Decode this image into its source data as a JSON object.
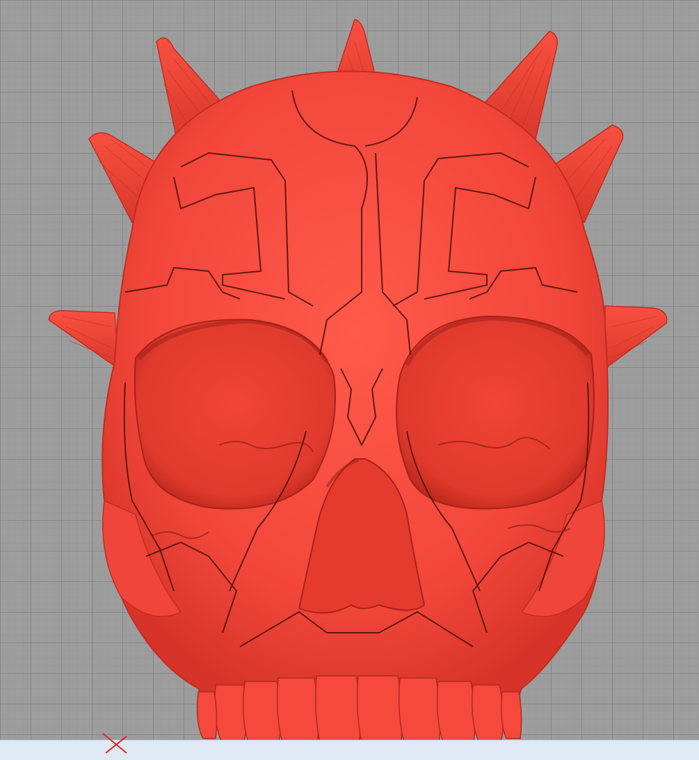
{
  "app": {
    "type": "3d-model-viewport"
  },
  "model": {
    "name": "",
    "color": "#f2463a",
    "shadow_color": "#b7241c",
    "highlight_color": "#ff6a5c"
  },
  "viewport": {
    "background": "#9d9d9d",
    "grid_color": "#7e7e7e"
  },
  "axis_widget": {
    "icon": "axis-x-icon",
    "color": "#e0201a"
  },
  "status_bar": {
    "color": "#dfe9f4"
  }
}
